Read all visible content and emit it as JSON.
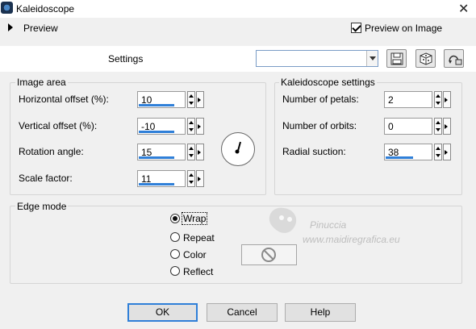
{
  "window": {
    "title": "Kaleidoscope",
    "close_glyph": "✕"
  },
  "preview": {
    "label": "Preview",
    "preview_on_image_label": "Preview on Image",
    "preview_on_image_checked": true
  },
  "settings": {
    "label": "Settings",
    "preset_value": "",
    "icons": [
      "save-icon",
      "randomize-icon",
      "reset-icon"
    ]
  },
  "image_area": {
    "title": "Image area",
    "horizontal_offset": {
      "label": "Horizontal offset (%):",
      "value": "10"
    },
    "vertical_offset": {
      "label": "Vertical offset (%):",
      "value": "-10"
    },
    "rotation_angle": {
      "label": "Rotation angle:",
      "value": "15"
    },
    "scale_factor": {
      "label": "Scale factor:",
      "value": "11"
    }
  },
  "kaleidoscope_settings": {
    "title": "Kaleidoscope settings",
    "number_of_petals": {
      "label": "Number of petals:",
      "value": "2"
    },
    "number_of_orbits": {
      "label": "Number of orbits:",
      "value": "0"
    },
    "radial_suction": {
      "label": "Radial suction:",
      "value": "38"
    }
  },
  "edge_mode": {
    "title": "Edge mode",
    "options": [
      {
        "label": "Wrap",
        "checked": true
      },
      {
        "label": "Repeat",
        "checked": false
      },
      {
        "label": "Color",
        "checked": false
      },
      {
        "label": "Reflect",
        "checked": false
      }
    ],
    "color_swatch_icon": "no-symbol-icon"
  },
  "watermark": {
    "line1": "Pinuccia",
    "line2": "www.maidiregrafica.eu"
  },
  "buttons": {
    "ok": "OK",
    "cancel": "Cancel",
    "help": "Help"
  },
  "colors": {
    "accent": "#2f7fd8",
    "background": "#f0f0f0"
  }
}
